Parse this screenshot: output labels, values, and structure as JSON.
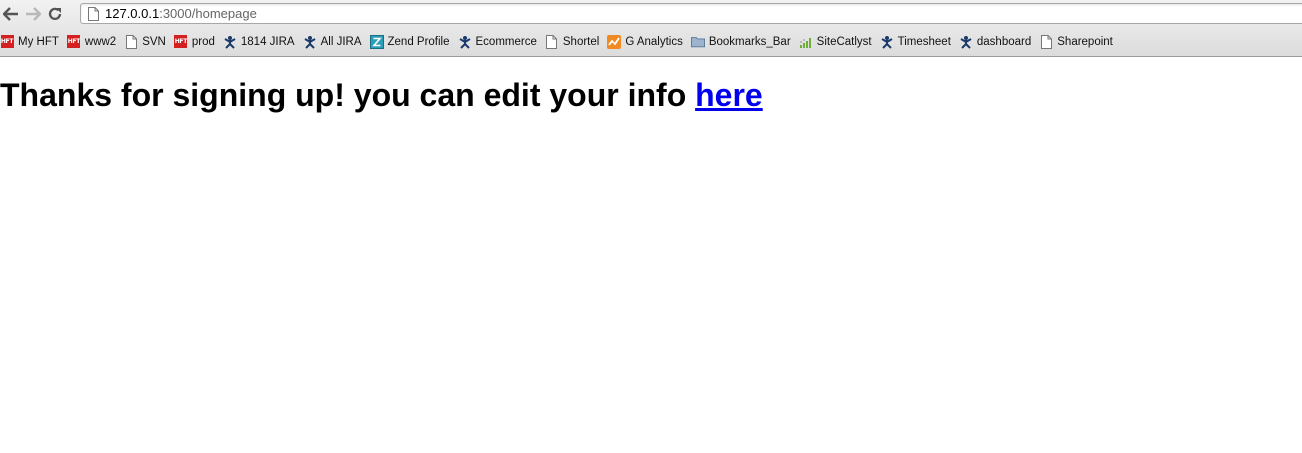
{
  "browser": {
    "url_host": "127.0.0.1",
    "url_rest": ":3000/homepage",
    "bookmarks": [
      {
        "label": "My HFT",
        "icon": "hft-icon"
      },
      {
        "label": "www2",
        "icon": "hft-icon"
      },
      {
        "label": "SVN",
        "icon": "page-icon"
      },
      {
        "label": "prod",
        "icon": "hft-icon"
      },
      {
        "label": "1814 JIRA",
        "icon": "jira-icon"
      },
      {
        "label": "All JIRA",
        "icon": "jira-icon"
      },
      {
        "label": "Zend Profile",
        "icon": "zend-icon"
      },
      {
        "label": "Ecommerce",
        "icon": "jira-icon"
      },
      {
        "label": "Shortel",
        "icon": "page-icon"
      },
      {
        "label": "G Analytics",
        "icon": "analytics-icon"
      },
      {
        "label": "Bookmarks_Bar",
        "icon": "folder-icon"
      },
      {
        "label": "SiteCatlyst",
        "icon": "sitecatalyst-icon"
      },
      {
        "label": "Timesheet",
        "icon": "jira-icon"
      },
      {
        "label": "dashboard",
        "icon": "jira-icon"
      },
      {
        "label": "Sharepoint",
        "icon": "page-icon"
      }
    ]
  },
  "page": {
    "heading_text": "Thanks for signing up! you can edit your info ",
    "link_text": "here"
  },
  "colors": {
    "link": "#0000ee",
    "hft_red": "#d42020"
  }
}
